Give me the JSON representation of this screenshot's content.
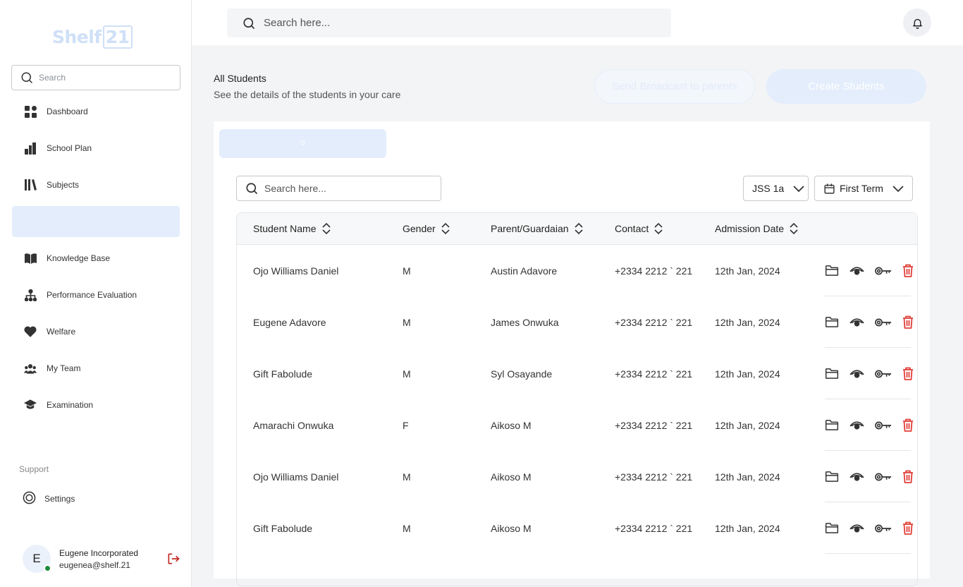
{
  "sidebar": {
    "logo_text": "Shelf",
    "logo_num": "21",
    "search_placeholder": "Search",
    "items": [
      {
        "label": "Dashboard",
        "icon": "grid-icon"
      },
      {
        "label": "School Plan",
        "icon": "bar-chart-icon"
      },
      {
        "label": "Subjects",
        "icon": "books-icon"
      },
      {
        "label": "",
        "icon": "",
        "active": true
      },
      {
        "label": "Knowledge Base",
        "icon": "open-book-icon"
      },
      {
        "label": "Performance Evaluation",
        "icon": "hierarchy-icon"
      },
      {
        "label": "Welfare",
        "icon": "heart-icon"
      },
      {
        "label": "My Team",
        "icon": "team-icon"
      },
      {
        "label": "Examination",
        "icon": "graduation-cap-icon"
      }
    ],
    "support_label": "Support",
    "settings_label": "Settings",
    "user": {
      "initial": "E",
      "name": "Eugene Incorporated",
      "email": "eugenea@shelf.21"
    }
  },
  "topbar": {
    "search_placeholder": "Search here..."
  },
  "header": {
    "title": "All Students",
    "subtitle": "See the details of the students in your care",
    "broadcast_label": "Send Broadcast to parents",
    "create_label": "Create Students"
  },
  "card": {
    "tab_label": "0",
    "search_placeholder": "Search here...",
    "class_filter": "JSS 1a",
    "term_filter": "First Term"
  },
  "table": {
    "columns": [
      "Student Name",
      "Gender",
      "Parent/Guardaian",
      "Contact",
      "Admission Date"
    ],
    "rows": [
      {
        "name": "Ojo Williams Daniel",
        "gender": "M",
        "parent": "Austin Adavore",
        "contact": "+2334 2212 ` 221",
        "date": "12th Jan, 2024"
      },
      {
        "name": "Eugene Adavore",
        "gender": "M",
        "parent": "James Onwuka",
        "contact": "+2334 2212 ` 221",
        "date": "12th Jan, 2024"
      },
      {
        "name": "Gift Fabolude",
        "gender": "M",
        "parent": "Syl Osayande",
        "contact": "+2334 2212 ` 221",
        "date": "12th Jan, 2024"
      },
      {
        "name": "Amarachi Onwuka",
        "gender": "F",
        "parent": "Aikoso M",
        "contact": "+2334 2212 ` 221",
        "date": "12th Jan, 2024"
      },
      {
        "name": "Ojo Williams Daniel",
        "gender": "M",
        "parent": "Aikoso M",
        "contact": "+2334 2212 ` 221",
        "date": "12th Jan, 2024"
      },
      {
        "name": "Gift Fabolude",
        "gender": "M",
        "parent": "Aikoso M",
        "contact": "+2334 2212 ` 221",
        "date": "12th Jan, 2024"
      }
    ]
  },
  "colors": {
    "accent_light": "#e3edfb",
    "delete": "#e0413a",
    "logout": "#c0281f",
    "online": "#1f8a3a"
  }
}
